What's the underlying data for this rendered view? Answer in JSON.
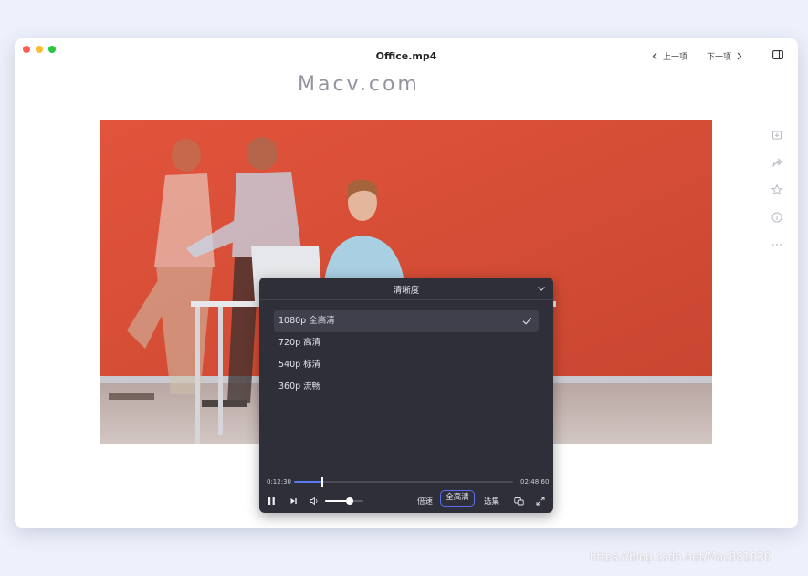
{
  "window": {
    "title": "Office.mp4"
  },
  "nav": {
    "prev_label": "上一项",
    "next_label": "下一项"
  },
  "sidebar_icons": [
    "download-icon",
    "share-icon",
    "star-icon",
    "info-icon",
    "more-icon"
  ],
  "video": {
    "watermark": "Macv.com"
  },
  "quality_panel": {
    "title": "清晰度",
    "options": [
      {
        "label": "1080p 全高清",
        "selected": true
      },
      {
        "label": "720p 高清",
        "selected": false
      },
      {
        "label": "540p 标清",
        "selected": false
      },
      {
        "label": "360p 流畅",
        "selected": false
      }
    ]
  },
  "player": {
    "current_time": "0:12:30",
    "duration": "02:48:60",
    "progress": 0.13,
    "volume": 0.65,
    "speed_label": "倍速",
    "quality_label": "全高清",
    "episodes_label": "选集"
  },
  "page_watermark": "https://blog.csdn.net/Mac881030",
  "colors": {
    "accent": "#5b6cf5",
    "video_bg": "#d9533d",
    "panel_bg": "#2f2f3a"
  }
}
